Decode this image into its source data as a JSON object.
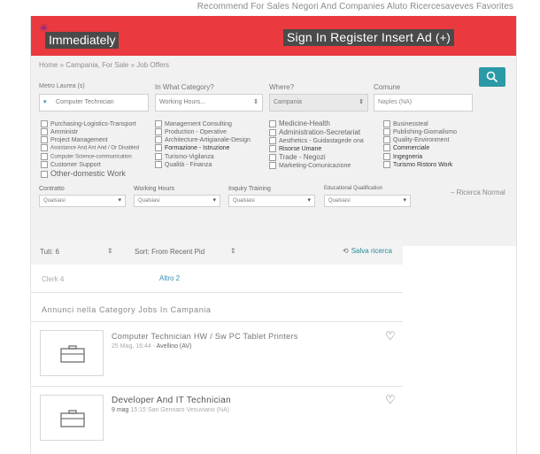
{
  "top_link": "Recommend For Sales Negori And Companies Aluto Ricercesaveves Favorites",
  "header": {
    "logo": "Immediately",
    "auth": "Sign In Register Insert Ad",
    "auth_plus": "(+)",
    "brand_color": "#ea3a3f"
  },
  "breadcrumb": "Home » Campania, For Sale » Job Offers",
  "search": {
    "what_label": "Metro Laurea (s)",
    "what_value": "Computer Technician",
    "category_label": "In What Category?",
    "category_value": "Working Hours...",
    "where_label": "Where?",
    "where_value": "Campania",
    "comune_label": "Comune",
    "comune_placeholder": "Naples (NA)"
  },
  "categories": {
    "col1": [
      "Purchasing-Logistics-Transport",
      "Amministr",
      "Project Management",
      "Assistance And Ant And / Or Disabled",
      "Computer Science-communication",
      "Customer Support",
      "Other-domestic Work"
    ],
    "col2": [
      "Management Consulting",
      "Production - Operative",
      "Architecture-Artigianale-Design",
      "Formazione - Istruzione",
      "Turismo-Vigilanza",
      "Qualità - Finanza"
    ],
    "col3": [
      "Medicine-Health",
      "Administration-Secretariat",
      "Aesthetics - Guidastagede ona",
      "Risorse Umane",
      "Trade - Negozi",
      "Marketing-Comunicazione"
    ],
    "col4": [
      "Businessteal",
      "Publishing-Giornalismo",
      "Quality-Environment",
      "Commerciale",
      "Ingegneria",
      "Turismo Ristoro Work"
    ]
  },
  "row2": {
    "contract_label": "Contratto",
    "contract_value": "Qualsiasi",
    "hours_label": "Working Hours",
    "hours_value": "Qualsiasi",
    "training_label": "Inquiry Training",
    "training_value": "Qualsiasi",
    "qualification_label": "Educational Qualification",
    "qualification_value": "Qualsiasi",
    "ricerca": "– Ricerca Normal"
  },
  "results_bar": {
    "all": "Tuti: 6",
    "sort": "Sort: From Recent Pid",
    "save": "Salva ricerca"
  },
  "chips": {
    "clerk": "Clerk  4",
    "altro": "Altro  2"
  },
  "section_title": "Annunci nella Category Jobs In Campania",
  "jobs": [
    {
      "title": "Computer Technician HW / Sw PC Tablet Printers",
      "date": "25 Mag, 16:44 -",
      "place": "Avellino (AV)"
    },
    {
      "title": "Developer And IT Technician",
      "date": "9 mag",
      "place": "15:15 San Gennaro Vesuviano (NA)"
    }
  ]
}
